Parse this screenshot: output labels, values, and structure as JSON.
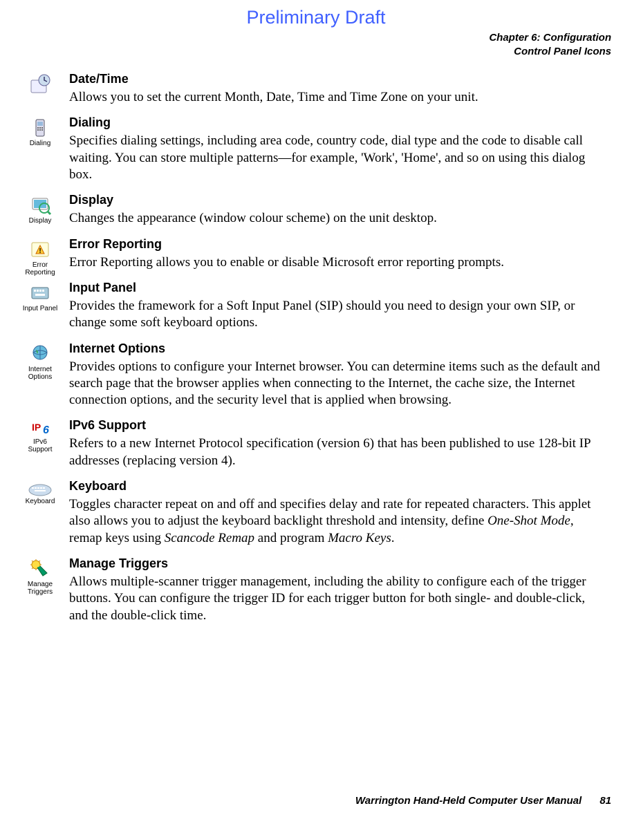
{
  "preliminary": "Preliminary Draft",
  "header": {
    "line1": "Chapter 6: Configuration",
    "line2": "Control Panel Icons"
  },
  "entries": [
    {
      "title": "Date/Time",
      "iconLabel": "",
      "body": "Allows you to set the current Month, Date, Time and Time Zone on your unit."
    },
    {
      "title": "Dialing",
      "iconLabel": "Dialing",
      "body": "Specifies dialing settings, including area code, country code, dial type and the code to disable call waiting. You can store multiple patterns—for example, 'Work', 'Home', and so on using this dialog box."
    },
    {
      "title": "Display",
      "iconLabel": "Display",
      "body": "Changes the appearance (window colour scheme) on the unit desktop."
    },
    {
      "title": "Error Reporting",
      "iconLabel": "Error Reporting",
      "body": "Error Reporting allows you to enable or disable Microsoft error reporting prompts."
    },
    {
      "title": "Input Panel",
      "iconLabel": "Input Panel",
      "body": "Provides the framework for a Soft Input Panel (SIP) should you need to design your own SIP, or change some soft keyboard options."
    },
    {
      "title": "Internet Options",
      "iconLabel": "Internet Options",
      "body": "Provides options to configure your Internet browser. You can determine items such as the default and search page that the browser applies when connecting to the Internet, the cache size, the Internet connection options, and the security level that is applied when browsing."
    },
    {
      "title": "IPv6 Support",
      "iconLabel": "IPv6 Support",
      "body": "Refers to a new Internet Protocol specification (version 6) that has been published to use 128-bit IP addresses (replacing version 4)."
    },
    {
      "title": "Keyboard",
      "iconLabel": "Keyboard",
      "body": "Toggles character repeat on and off and specifies delay and rate for repeated characters. This applet also allows you to adjust the keyboard backlight threshold and intensity, define One-Shot Mode, remap keys using Scancode Remap and program Macro Keys."
    },
    {
      "title": "Manage Triggers",
      "iconLabel": "Manage Triggers",
      "body": "Allows multiple-scanner trigger management, including the ability to configure each of the trigger buttons. You can configure the trigger ID for each trigger button for both single- and double-click, and the double-click time."
    }
  ],
  "footer": {
    "text": "Warrington Hand-Held Computer User Manual",
    "page": "81"
  }
}
